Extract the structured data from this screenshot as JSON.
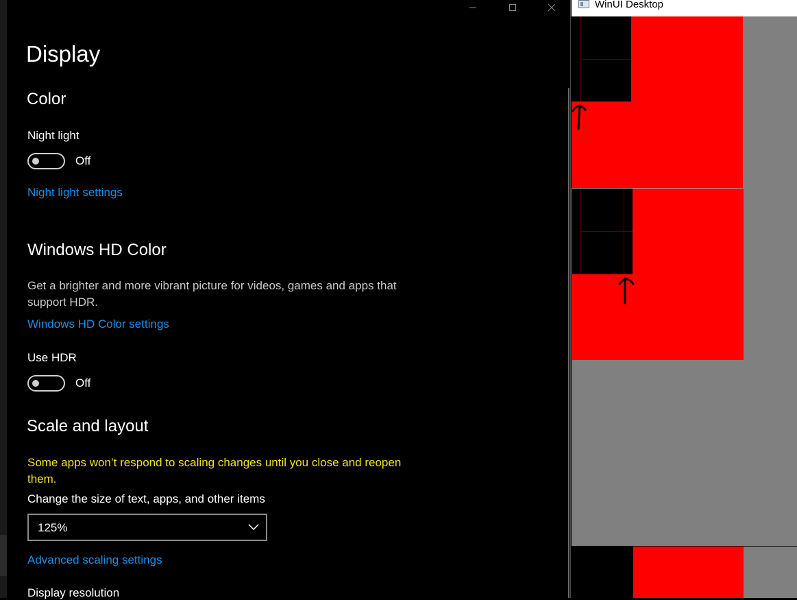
{
  "settings": {
    "page_title": "Display",
    "caption_buttons": {
      "minimize": "minimize-icon",
      "maximize": "maximize-icon",
      "close": "close-icon"
    },
    "color_section": {
      "heading": "Color",
      "night_light_label": "Night light",
      "night_light_state": "Off",
      "night_light_settings_link": "Night light settings"
    },
    "hdr_section": {
      "heading": "Windows HD Color",
      "description": "Get a brighter and more vibrant picture for videos, games and apps that support HDR.",
      "settings_link": "Windows HD Color settings",
      "use_hdr_label": "Use HDR",
      "use_hdr_state": "Off"
    },
    "scale_section": {
      "heading": "Scale and layout",
      "warning": "Some apps won’t respond to scaling changes until you close and reopen them.",
      "size_label": "Change the size of text, apps, and other items",
      "size_value": "125%",
      "advanced_link": "Advanced scaling settings",
      "resolution_label": "Display resolution"
    },
    "colors": {
      "link": "#1a8fe8",
      "warning": "#f2e12a"
    }
  },
  "winui_window": {
    "title": "WinUI Desktop",
    "colors": {
      "panel_red": "#ff0000",
      "background_gray": "#808080"
    }
  }
}
